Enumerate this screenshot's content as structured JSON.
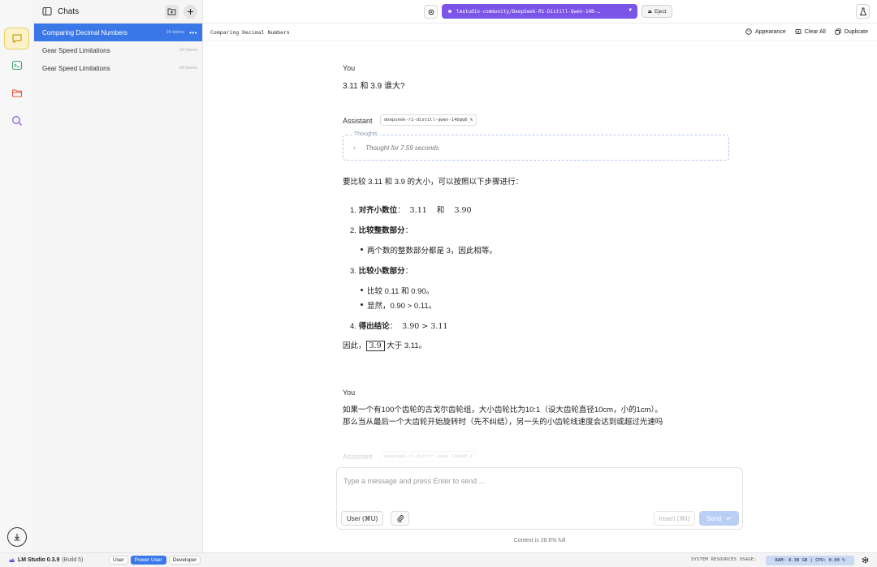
{
  "window": {
    "traffic_colors": [
      "#ee5f57",
      "#f6bd3b",
      "#5fc454"
    ]
  },
  "rail": {
    "items": [
      {
        "name": "chat-icon",
        "active": true
      },
      {
        "name": "terminal-icon",
        "active": false
      },
      {
        "name": "folder-icon",
        "active": false
      },
      {
        "name": "search-icon",
        "active": false
      }
    ],
    "accent": "#e6b83a"
  },
  "sidebar": {
    "title": "Chats",
    "chats": [
      {
        "name": "Comparing Decimal Numbers",
        "tokens": "2K tokens",
        "active": true
      },
      {
        "name": "Gear Speed Limitations",
        "tokens": "1K tokens",
        "active": false
      },
      {
        "name": "Gear Speed Limitations",
        "tokens": "2K tokens",
        "active": false
      }
    ]
  },
  "topbar": {
    "model": "lmstudio-community/DeepSeek-R1-Distill-Qwen-14B-…",
    "eject_label": "Eject",
    "model_color": "#7b55e8"
  },
  "subbar": {
    "chat_title": "Comparing Decimal Numbers",
    "appearance_label": "Appearance",
    "clear_label": "Clear All",
    "duplicate_label": "Duplicate"
  },
  "conversation": {
    "msg1": {
      "role": "You",
      "text": "3.11 和 3.9 谁大?"
    },
    "msg2": {
      "role": "Assistant",
      "model_badge": "deepseek-r1-distill-qwen-14b@q6_k",
      "thoughts_label": "Thoughts",
      "thought_summary": "Thought for 7.59 seconds",
      "intro": "要比较 3.11 和 3.9 的大小，可以按照以下步骤进行：",
      "step1_num": "1.",
      "step1_bold": "对齐小数位",
      "step1_rest": "：  3.11    和    3.90",
      "step2_num": "2.",
      "step2_bold": "比较整数部分",
      "step2_rest": "：",
      "step2_bullet": "两个数的整数部分都是 3，因此相等。",
      "step3_num": "3.",
      "step3_bold": "比较小数部分",
      "step3_rest": "：",
      "step3_bullet1": "比较 0.11 和 0.90。",
      "step3_bullet2": "显然，0.90 > 0.11。",
      "step4_num": "4.",
      "step4_bold": "得出结论",
      "step4_rest": "：  3.90 > 3.11",
      "conclusion_pre": "因此，",
      "conclusion_box": "3.9",
      "conclusion_post": " 大于 3.11。"
    },
    "msg3": {
      "role": "You",
      "line1": "如果一个有100个齿轮的古戈尔齿轮组，大小齿轮比为10:1（设大齿轮直径10cm，小的1cm）。",
      "line2": "那么当从最后一个大齿轮开始旋转时（先不纠结），另一头的小齿轮线速度会达到或超过光速吗"
    },
    "msg4": {
      "role": "Assistant",
      "model_badge": "deepseek-r1-distill-qwen-14b@q6_k"
    }
  },
  "composer": {
    "placeholder": "Type a message and press Enter to send ...",
    "role_button": "User (⌘U)",
    "insert_label": "Insert (⌘I)",
    "send_label": "Send",
    "context_note": "Context is 28.6% full"
  },
  "statusbar": {
    "app_name": "LM Studio 0.3.9",
    "build": "(Build 5)",
    "modes": [
      {
        "label": "User",
        "active": false
      },
      {
        "label": "Power User",
        "active": true
      },
      {
        "label": "Developer",
        "active": false
      }
    ],
    "sys_label": "SYSTEM RESOURCES USAGE:",
    "sys_values": "RAM: 8.38 GB  |  CPU: 0.00 %"
  }
}
